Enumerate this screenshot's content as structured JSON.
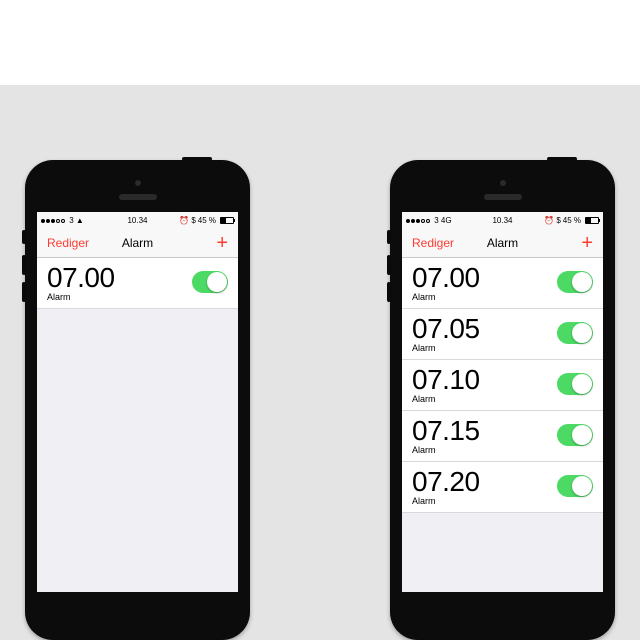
{
  "both": {
    "status_time": "10.34",
    "battery_pct": "45 %",
    "carrier_left": "3",
    "nav_edit": "Rediger",
    "nav_title": "Alarm",
    "nav_add": "+",
    "alarm_label": "Alarm"
  },
  "phones": {
    "left": {
      "signal_type": "wifi",
      "alarms": [
        {
          "time": "07.00",
          "on": true
        }
      ]
    },
    "right": {
      "signal_type": "4G",
      "alarms": [
        {
          "time": "07.00",
          "on": true
        },
        {
          "time": "07.05",
          "on": true
        },
        {
          "time": "07.10",
          "on": true
        },
        {
          "time": "07.15",
          "on": true
        },
        {
          "time": "07.20",
          "on": true
        }
      ]
    }
  }
}
